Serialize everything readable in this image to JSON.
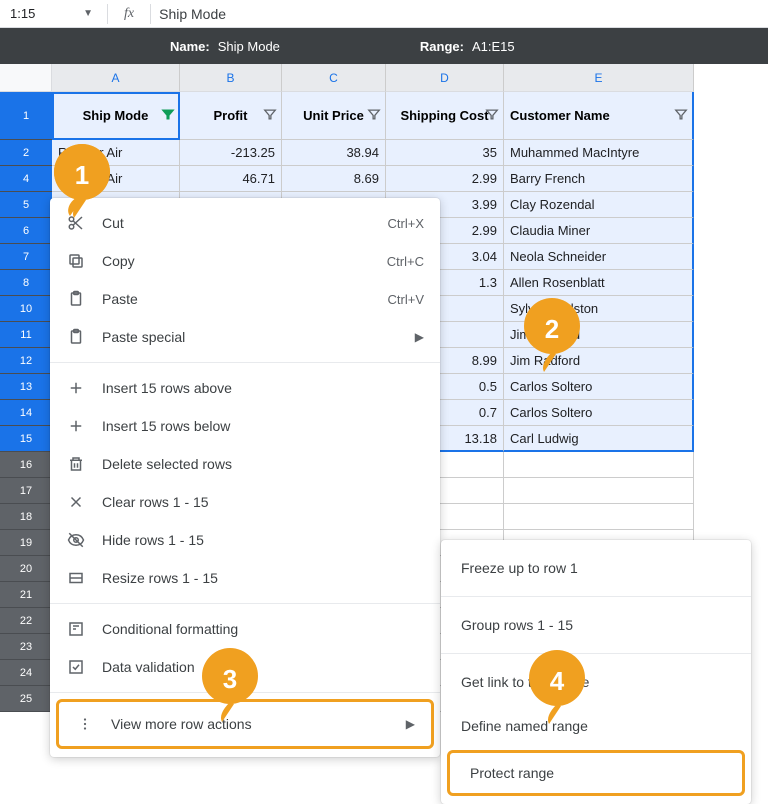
{
  "formula_bar": {
    "namebox": "1:15",
    "fx": "fx",
    "content": "Ship Mode"
  },
  "range_bar": {
    "name_label": "Name:",
    "name_value": "Ship Mode",
    "range_label": "Range:",
    "range_value": "A1:E15"
  },
  "columns": [
    "A",
    "B",
    "C",
    "D",
    "E"
  ],
  "headers": {
    "A": "Ship Mode",
    "B": "Profit",
    "C": "Unit Price",
    "D": "Shipping Cost",
    "E": "Customer Name"
  },
  "data_rows": [
    {
      "n": "2",
      "A": "Regular Air",
      "B": "-213.25",
      "C": "38.94",
      "D": "35",
      "E": "Muhammed MacIntyre"
    },
    {
      "n": "4",
      "A": "Regular Air",
      "B": "46.71",
      "C": "8.69",
      "D": "2.99",
      "E": "Barry French"
    },
    {
      "n": "5",
      "A": "",
      "B": "",
      "C": "",
      "D": "3.99",
      "E": "Clay Rozendal"
    },
    {
      "n": "6",
      "A": "",
      "B": "",
      "C": "",
      "D": "2.99",
      "E": "Claudia Miner"
    },
    {
      "n": "7",
      "A": "",
      "B": "",
      "C": "",
      "D": "3.04",
      "E": "Neola Schneider"
    },
    {
      "n": "8",
      "A": "",
      "B": "",
      "C": "",
      "D": "1.3",
      "E": "Allen Rosenblatt"
    },
    {
      "n": "10",
      "A": "",
      "B": "",
      "C": "",
      "D": "",
      "E": "Sylvia Foulston"
    },
    {
      "n": "11",
      "A": "",
      "B": "",
      "C": "",
      "D": "",
      "E": "Jim Radford"
    },
    {
      "n": "12",
      "A": "",
      "B": "",
      "C": "",
      "D": "8.99",
      "E": "Jim Radford"
    },
    {
      "n": "13",
      "A": "",
      "B": "",
      "C": "",
      "D": "0.5",
      "E": "Carlos Soltero"
    },
    {
      "n": "14",
      "A": "",
      "B": "",
      "C": "",
      "D": "0.7",
      "E": "Carlos Soltero"
    },
    {
      "n": "15",
      "A": "",
      "B": "",
      "C": "",
      "D": "13.18",
      "E": "Carl Ludwig"
    }
  ],
  "empty_rows": [
    "16",
    "17",
    "18",
    "19",
    "20",
    "21",
    "22",
    "23",
    "24",
    "25"
  ],
  "context_menu": {
    "cut": "Cut",
    "cut_sc": "Ctrl+X",
    "copy": "Copy",
    "copy_sc": "Ctrl+C",
    "paste": "Paste",
    "paste_sc": "Ctrl+V",
    "paste_special": "Paste special",
    "insert_above": "Insert 15 rows above",
    "insert_below": "Insert 15 rows below",
    "delete_rows": "Delete selected rows",
    "clear_rows": "Clear rows 1 - 15",
    "hide_rows": "Hide rows 1 - 15",
    "resize_rows": "Resize rows 1 - 15",
    "cond_format": "Conditional formatting",
    "data_validation": "Data validation",
    "view_more": "View more row actions"
  },
  "submenu": {
    "freeze": "Freeze up to row 1",
    "group": "Group rows 1 - 15",
    "get_link": "Get link to this range",
    "define_named": "Define named range",
    "protect": "Protect range"
  },
  "annotations": {
    "1": "1",
    "2": "2",
    "3": "3",
    "4": "4"
  },
  "colors": {
    "balloon": "#f0a020",
    "selection": "#1a73e8"
  }
}
